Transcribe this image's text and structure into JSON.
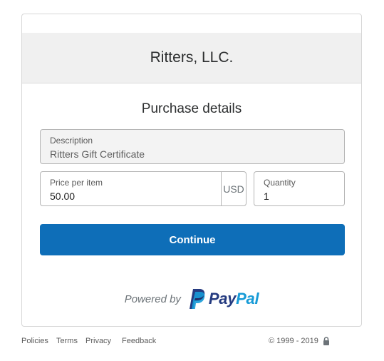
{
  "merchant": {
    "name": "Ritters, LLC."
  },
  "form": {
    "heading": "Purchase details",
    "description": {
      "label": "Description",
      "value": "Ritters Gift Certificate"
    },
    "price": {
      "label": "Price per item",
      "value": "50.00",
      "currency": "USD"
    },
    "quantity": {
      "label": "Quantity",
      "value": "1"
    },
    "continue_label": "Continue"
  },
  "branding": {
    "powered_by": "Powered by",
    "logo_word_1": "Pay",
    "logo_word_2": "Pal",
    "logo_icon": "paypal-p-icon"
  },
  "footer": {
    "links": [
      "Policies",
      "Terms",
      "Privacy",
      "Feedback"
    ],
    "copyright": "© 1999 - 2019",
    "lock_icon": "lock-icon"
  },
  "colors": {
    "button": "#0e6eb8",
    "paypal_dark": "#253b80",
    "paypal_light": "#179bd7"
  }
}
